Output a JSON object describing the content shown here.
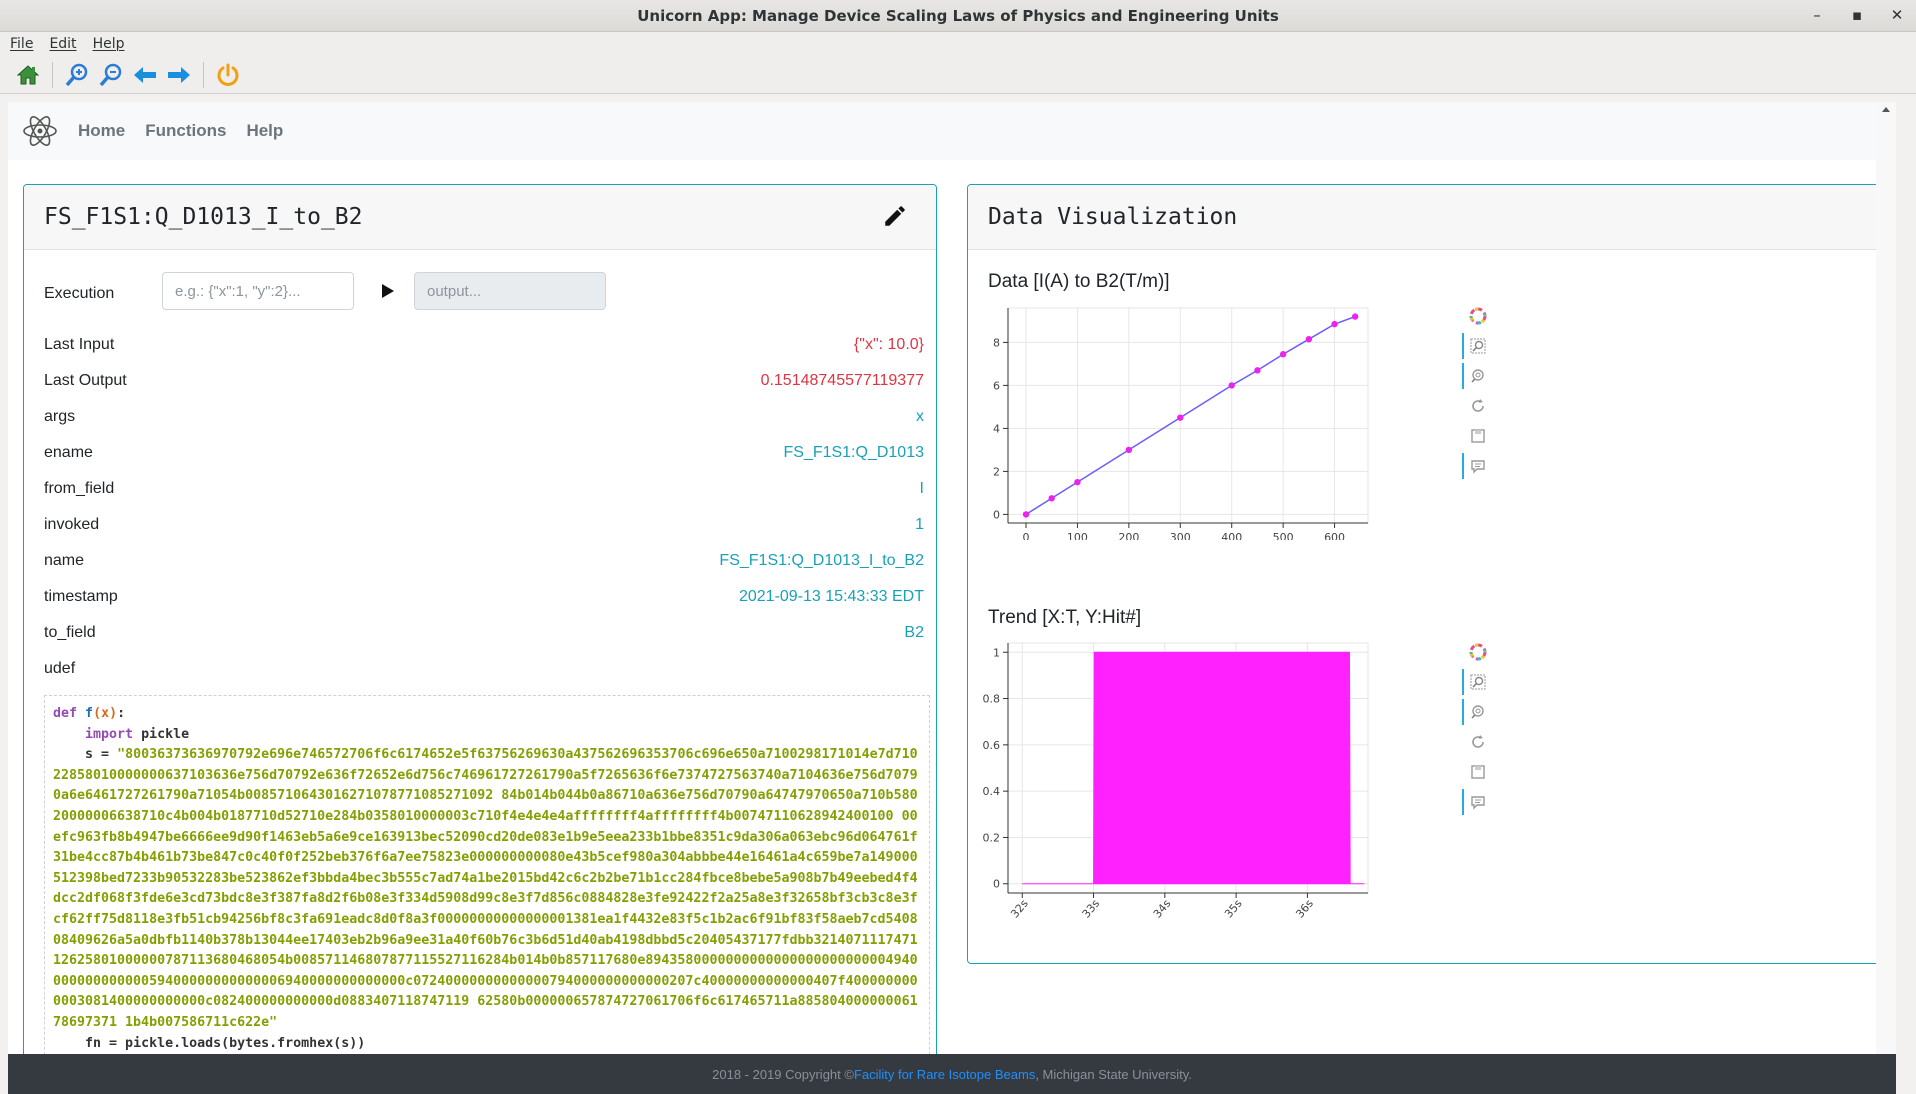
{
  "window": {
    "title": "Unicorn App: Manage Device Scaling Laws of Physics and Engineering Units",
    "buttons": [
      "–",
      "▪",
      "✕"
    ]
  },
  "menu": [
    "File",
    "Edit",
    "Help"
  ],
  "toolbar_icons": [
    "home-icon",
    "zoom-in-icon",
    "zoom-out-icon",
    "back-icon",
    "forward-icon",
    "power-icon"
  ],
  "nav": {
    "links": [
      "Home",
      "Functions",
      "Help"
    ]
  },
  "function_card": {
    "title": "FS_F1S1:Q_D1013_I_to_B2",
    "execution_label": "Execution",
    "input_placeholder": "e.g.: {\"x\":1, \"y\":2}...",
    "output_placeholder": "output...",
    "props": [
      {
        "key": "Last Input",
        "value": "{\"x\": 10.0}",
        "color": "red"
      },
      {
        "key": "Last Output",
        "value": "0.15148745577119377",
        "color": "red"
      },
      {
        "key": "args",
        "value": "x",
        "color": "teal"
      },
      {
        "key": "ename",
        "value": "FS_F1S1:Q_D1013",
        "color": "teal"
      },
      {
        "key": "from_field",
        "value": "I",
        "color": "teal"
      },
      {
        "key": "invoked",
        "value": "1",
        "color": "teal"
      },
      {
        "key": "name",
        "value": "FS_F1S1:Q_D1013_I_to_B2",
        "color": "teal"
      },
      {
        "key": "timestamp",
        "value": "2021-09-13 15:43:33 EDT",
        "color": "teal"
      },
      {
        "key": "to_field",
        "value": "B2",
        "color": "teal"
      },
      {
        "key": "udef",
        "value": "",
        "color": "teal"
      }
    ],
    "code": {
      "def": "def",
      "fname": "f",
      "params": "(x)",
      "colon": ":",
      "import_kw": "import",
      "import_mod": "pickle",
      "s_assign": "s = ",
      "s_value": "\"80036373636970792e696e746572706f6c6174652e5f63756269630a437562696353706c696e650a7100298171014e7d71022858010000000637103636e756d70792e636f72652e6d756c746961727261790a5f7265636f6e7374727563740a7104636e756d70790a6e6461727261790a71054b0085710643016271078771085271092 84b014b044b0a86710a636e756d70790a64747970650a710b58020000006638710c4b004b0187710d52710e284b0358010000003c710f4e4e4e4affffffff4affffffff4b00747110628942400100 00efc963fb8b4947be6666ee9d90f1463eb5a6e9ce163913bec52090cd20de083e1b9e5eea233b1bbe8351c9da306a063ebc96d064761f31be4cc87b4b461b73be847c0c40f0f252beb376f6a7ee75823e000000000080e43b5cef980a304abbbe44e16461a4c659be7a149000512398bed7233b90532283be523862ef3bbda4bec3b555c7ad74a1be2015bd42c6c2b2be71b1cc284fbce8bebe5a908b7b49eebed4f4dcc2df068f3fde6e3cd73bdc8e3f387fa8d2f6b08e3f334d5908d99c8e3f7d856c0884828e3fe92422f2a25a8e3f32658bf3cb3c8e3fcf62ff75d8118e3fb51cb94256bf8c3fa691eadc8d0f8a3f00000000000000001381ea1f4432e83f5c1b2ac6f91bf83f58aeb7cd540808409626a5a0dbfb1140b378b13044ee17403eb2b96a9ee31a40f60b76c3b6d51d40ab4198dbbd5c20405437177fdbb321407111747112625801000000787113680468054b008571146807877115527116284b014b0b857117680e894358000000000000000000000000494000000000000059400000000000006940000000000000c07240000000000000794000000000000207c40000000000000407f4000000000003081400000000000c082400000000000d0883407118747119 62580b000000657874727061706f6c617465711a88580400000006178697371 1b4b007586711c622e\"",
      "fn_line": "    fn = pickle.loads(bytes.fromhex(s))"
    }
  },
  "viz_card": {
    "title": "Data Visualization",
    "plot1_title": "Data [I(A) to B2(T/m)]",
    "plot2_title": "Trend [X:T, Y:Hit#]"
  },
  "bokeh_tools": [
    "bokeh-logo-icon",
    "box-zoom-icon",
    "wheel-zoom-icon",
    "reset-icon",
    "save-icon",
    "hover-icon"
  ],
  "chart_data": [
    {
      "type": "line",
      "title": "Data [I(A) to B2(T/m)]",
      "x": [
        0,
        50,
        100,
        200,
        300,
        400,
        450,
        500,
        550,
        600,
        640
      ],
      "values": [
        0,
        0.75,
        1.5,
        3.0,
        4.5,
        6.0,
        6.7,
        7.45,
        8.15,
        8.85,
        9.2
      ],
      "xticks": [
        "0",
        "100",
        "200",
        "300",
        "400",
        "500",
        "600"
      ],
      "yticks": [
        "0",
        "2",
        "4",
        "6",
        "8"
      ],
      "xlim": [
        -35,
        665
      ],
      "ylim": [
        -0.4,
        9.6
      ],
      "grid": true,
      "line_color": "#6a5cff",
      "marker_color": "#ee22ee"
    },
    {
      "type": "area",
      "title": "Trend [X:T, Y:Hit#]",
      "x": [
        32.0,
        33.0,
        33.01,
        36.59,
        36.6,
        36.8
      ],
      "values": [
        0,
        0,
        1,
        1,
        0,
        0
      ],
      "xticks": [
        "32s",
        "33s",
        "34s",
        "35s",
        "36s"
      ],
      "yticks": [
        "0",
        "0.2",
        "0.4",
        "0.6",
        "0.8",
        "1"
      ],
      "xlim": [
        31.8,
        36.85
      ],
      "ylim": [
        -0.04,
        1.04
      ],
      "grid": true,
      "fill_color": "#ff22ff"
    }
  ],
  "footer": {
    "prefix": "2018 - 2019 Copyright © ",
    "link": "Facility for Rare Isotope Beams",
    "suffix": ", Michigan State University."
  }
}
